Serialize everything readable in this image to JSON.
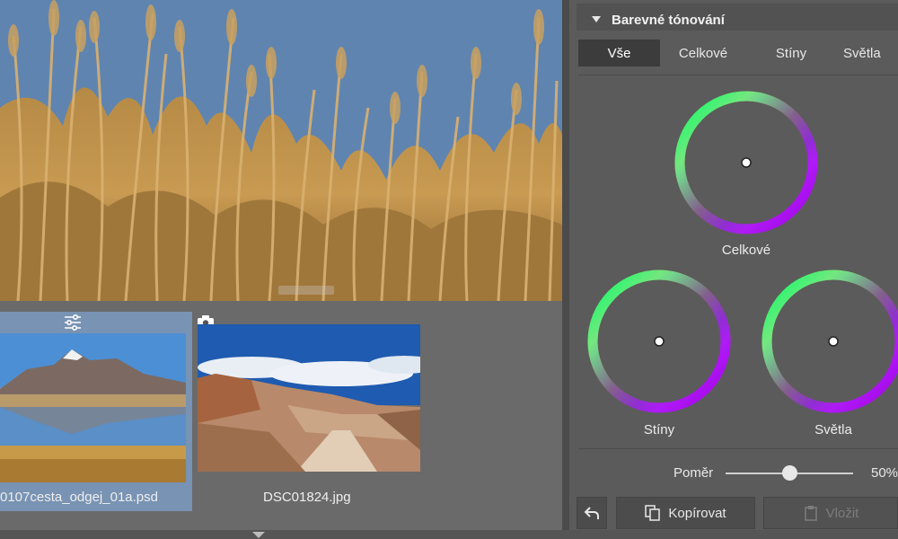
{
  "colors": {
    "panel_bg": "#5b5b5b",
    "selected_thumb_bg": "#7893b3",
    "tab_active_bg": "#3c3c3c"
  },
  "filmstrip": {
    "items": [
      {
        "filename": "0107cesta_odgej_01a.psd",
        "badge_icon": "adjustments-icon",
        "selected": true
      },
      {
        "filename": "DSC01824.jpg",
        "badge_icon": "camera-icon",
        "selected": false
      }
    ]
  },
  "panel": {
    "title": "Barevné tónování",
    "tabs": [
      {
        "label": "Vše",
        "active": true
      },
      {
        "label": "Celkové",
        "active": false
      },
      {
        "label": "Stíny",
        "active": false
      },
      {
        "label": "Světla",
        "active": false
      }
    ],
    "wheels": {
      "overall_label": "Celkové",
      "shadows_label": "Stíny",
      "highlights_label": "Světla"
    },
    "ratio": {
      "label": "Poměr",
      "value_text": "50%",
      "value": 0.5
    },
    "buttons": {
      "undo_icon": "undo-icon",
      "copy_label": "Kopírovat",
      "paste_label": "Vložit"
    }
  }
}
